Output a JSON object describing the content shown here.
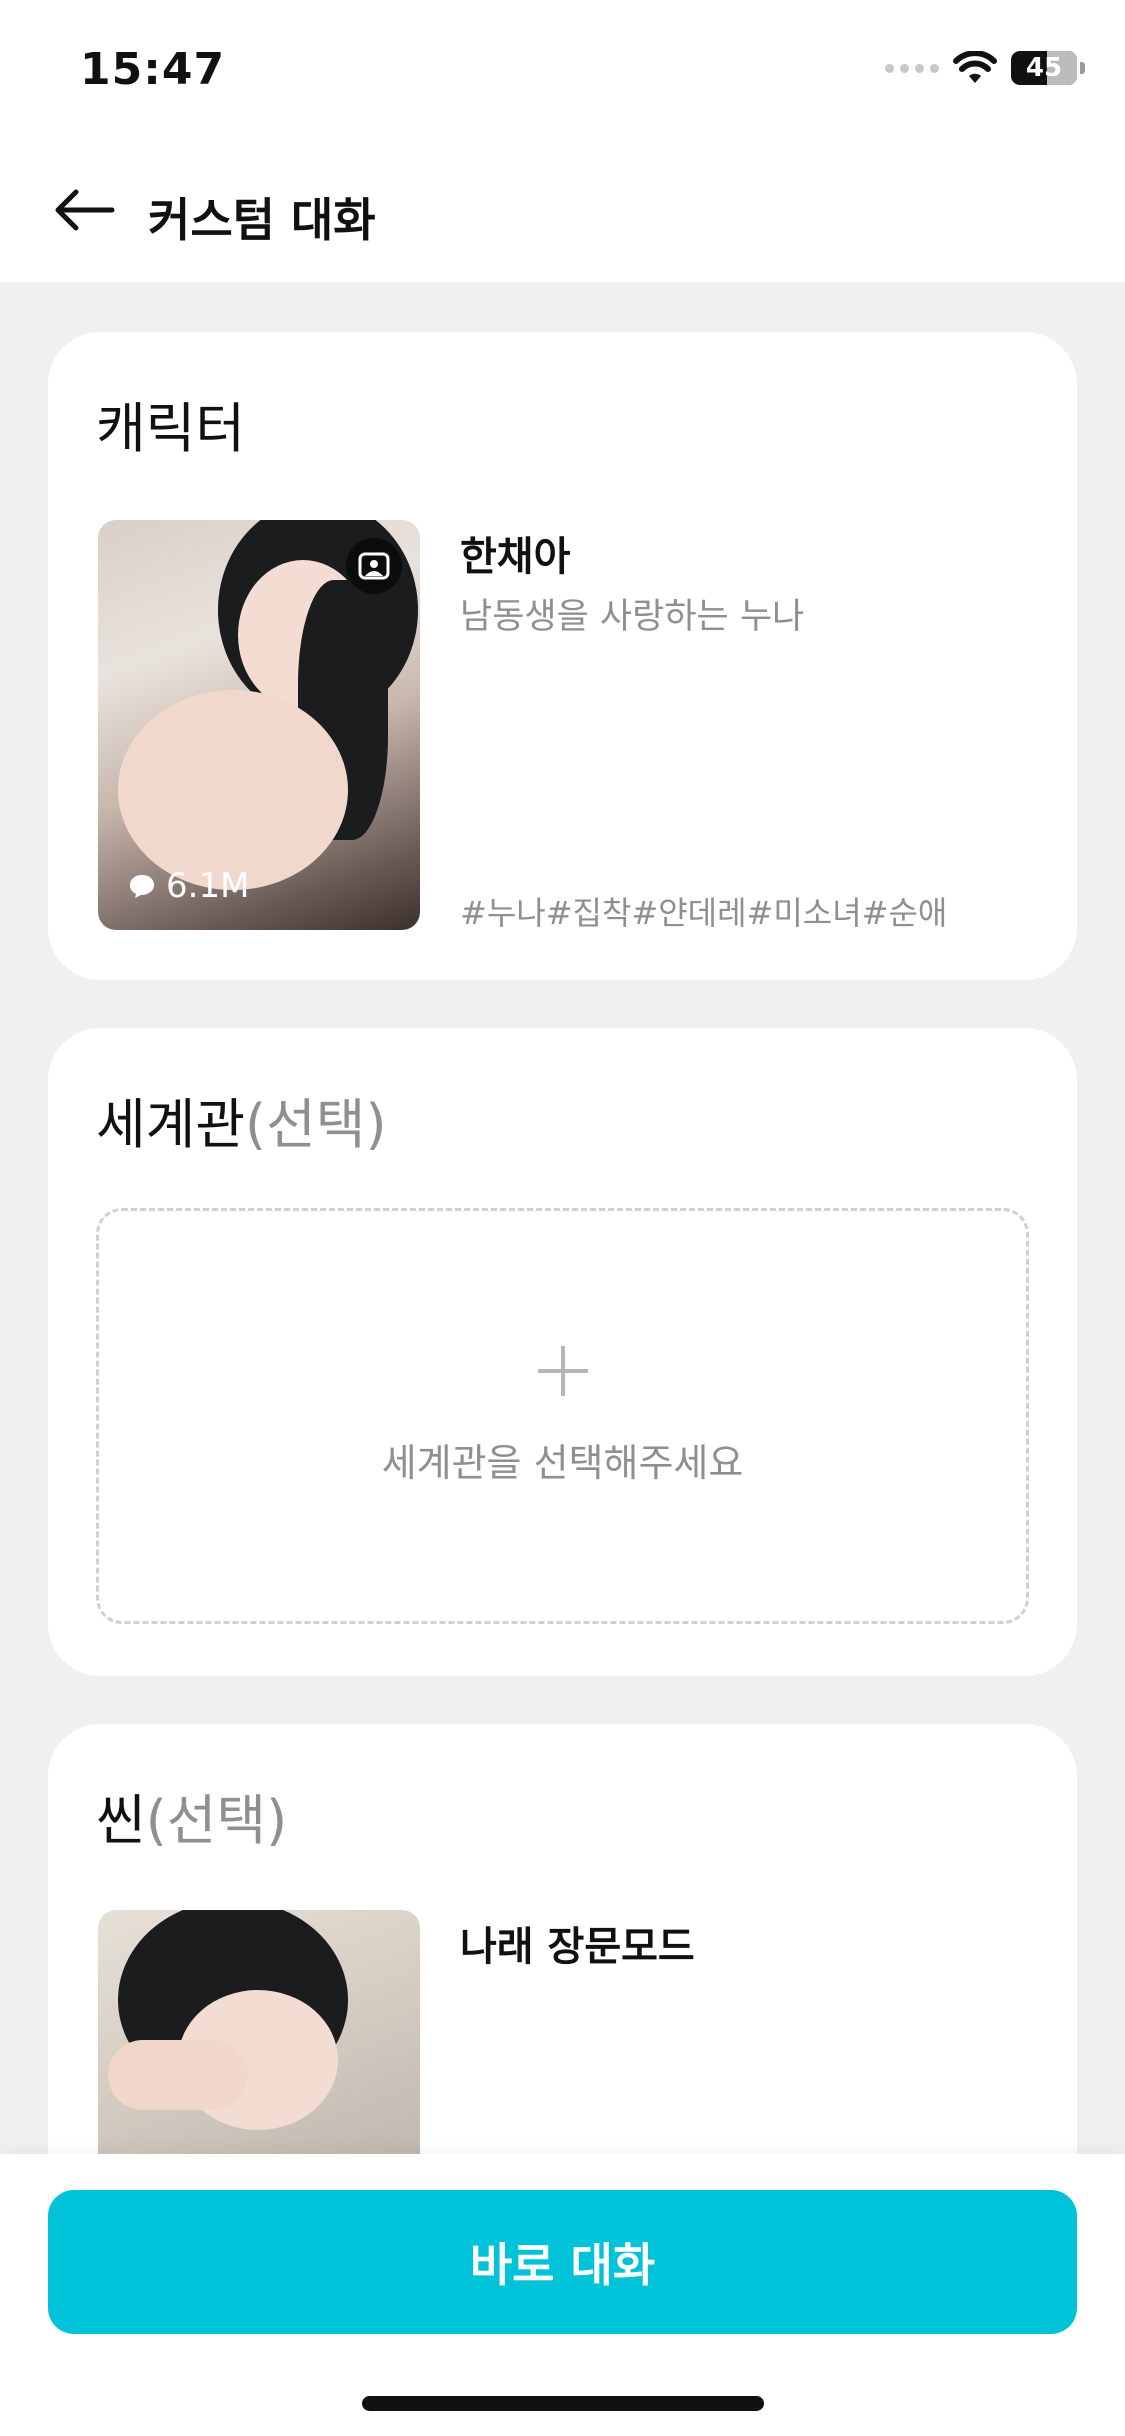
{
  "status": {
    "time": "15:47",
    "battery": "45"
  },
  "nav": {
    "title": "커스텀 대화"
  },
  "character_section": {
    "title": "캐릭터",
    "name": "한채아",
    "description": "남동생을 사랑하는 누나",
    "tags": "#누나#집착#얀데레#미소녀#순애",
    "views": "6.1M"
  },
  "world_section": {
    "title": "세계관",
    "optional": "(선택)",
    "placeholder": "세계관을 선택해주세요"
  },
  "scene_section": {
    "title": "씬",
    "optional": "(선택)",
    "name": "나래 장문모드"
  },
  "cta": {
    "label": "바로 대화"
  },
  "colors": {
    "accent": "#00c2d8",
    "background": "#f0f0f2"
  }
}
